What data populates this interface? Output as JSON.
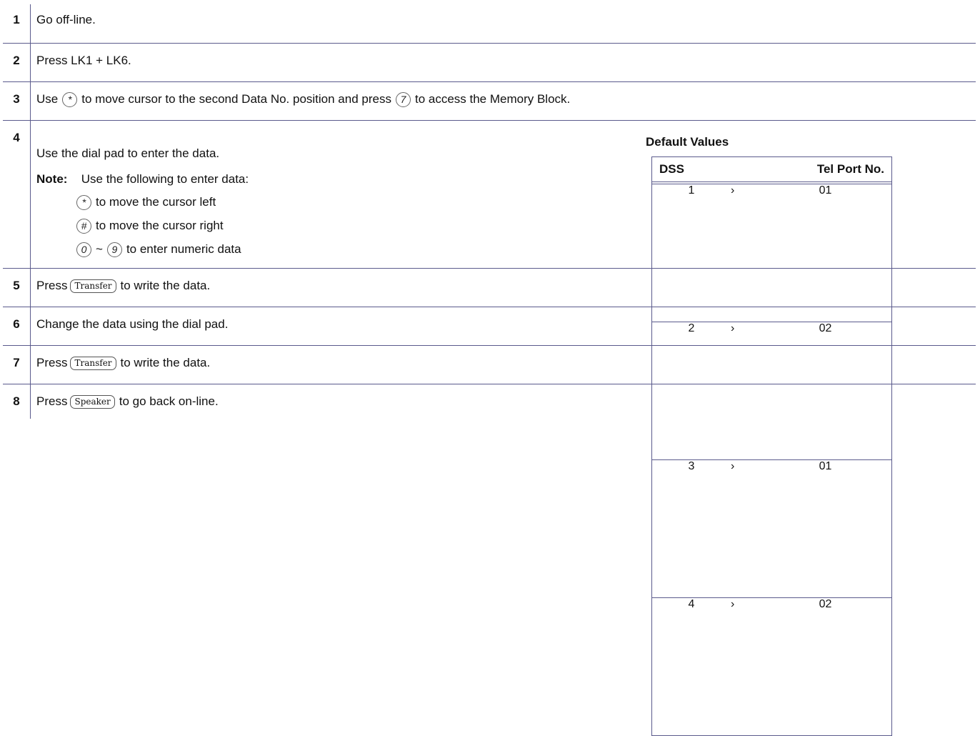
{
  "steps": [
    {
      "num": "1",
      "text": "Go off-line."
    },
    {
      "num": "2",
      "text": "Press LK1 + LK6."
    },
    {
      "num": "3",
      "pre": "Use",
      "key1": "*",
      "mid": "to move cursor to the second Data No. position and press",
      "key2": "7",
      "post": "to access the Memory Block."
    },
    {
      "num": "4",
      "intro": "Use the dial pad to enter the data.",
      "note_label": "Note:",
      "note_text": "Use the following to enter data:",
      "note_items": [
        {
          "key": "*",
          "text": "to move the cursor left"
        },
        {
          "key": "#",
          "text": "to move the cursor right"
        },
        {
          "key_from": "0",
          "tilde": "~",
          "key_to": "9",
          "text": "to enter numeric data"
        }
      ]
    },
    {
      "num": "5",
      "pre": "Press",
      "key": "Transfer",
      "post": "to write the data."
    },
    {
      "num": "6",
      "text": "Change the data using the dial pad."
    },
    {
      "num": "7",
      "pre": "Press",
      "key": "Transfer",
      "post": "to write the data."
    },
    {
      "num": "8",
      "pre": "Press",
      "key": "Speaker",
      "post": "to go back on-line."
    }
  ],
  "defaults": {
    "title": "Default Values",
    "col_dss": "DSS",
    "col_port": "Tel Port No.",
    "rows": [
      {
        "dss": "1",
        "arrow": "›",
        "port": "01"
      },
      {
        "dss": "2",
        "arrow": "›",
        "port": "02"
      },
      {
        "dss": "3",
        "arrow": "›",
        "port": "01"
      },
      {
        "dss": "4",
        "arrow": "›",
        "port": "02"
      }
    ]
  }
}
